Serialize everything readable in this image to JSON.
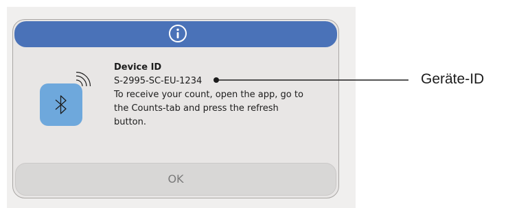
{
  "dialog": {
    "header_icon": "info-icon",
    "device_icon": "bluetooth-icon",
    "title": "Device ID",
    "device_id": "S-2995-SC-EU-1234",
    "message_line1": "To receive your count, open the app, go to",
    "message_line2": "the Counts-tab and press the refresh",
    "message_line3": "button.",
    "ok_label": "OK"
  },
  "callout": {
    "label": "Geräte-ID"
  },
  "colors": {
    "header": "#4a72b8",
    "dialog_bg": "#e8e6e5",
    "bluetooth_tile": "#6ea8dc",
    "ok_button": "#d8d7d6"
  }
}
